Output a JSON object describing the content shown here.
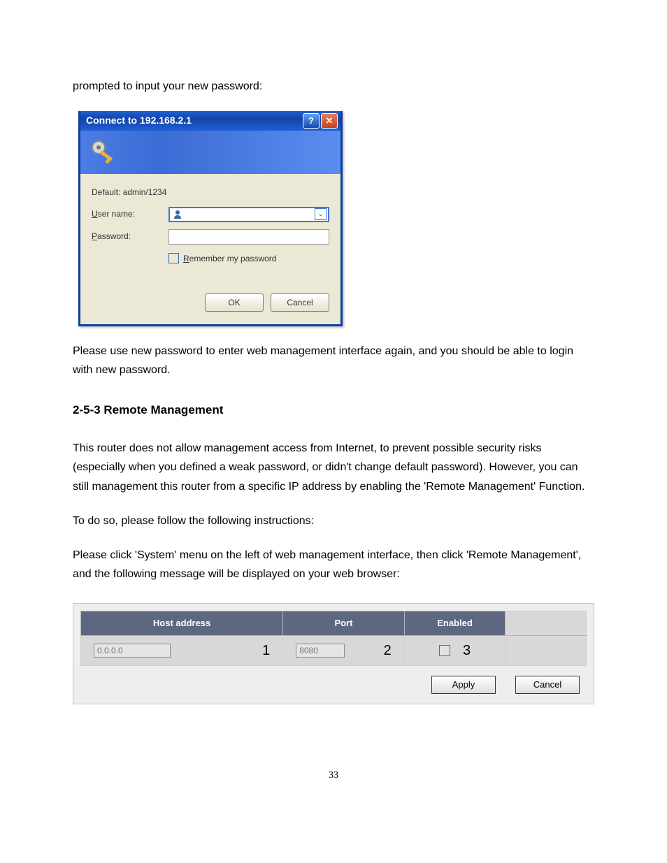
{
  "intro_text": "prompted to input your new password:",
  "dialog": {
    "title": "Connect to 192.168.2.1",
    "hint": "Default: admin/1234",
    "labels": {
      "user_prefix": "U",
      "user_rest": "ser name:",
      "pass_prefix": "P",
      "pass_rest": "assword:",
      "remember_prefix": "R",
      "remember_rest": "emember my password"
    },
    "ok": "OK",
    "cancel": "Cancel"
  },
  "post_dialog": "Please use new password to enter web management interface again, and you should be able to login with new password.",
  "section_heading": "2-5-3 Remote Management",
  "section_p1": "This router does not allow management access from Internet, to prevent possible security risks (especially when you defined a weak password, or didn't change default password). However, you can still management this router from a specific IP address by enabling the 'Remote Management' Function.",
  "section_p2": "To do so, please follow the following instructions:",
  "section_p3": "Please click 'System' menu on the left of web management interface, then click 'Remote Management', and the following message will be displayed on your web browser:",
  "remote": {
    "headers": {
      "host": "Host address",
      "port": "Port",
      "enabled": "Enabled"
    },
    "row": {
      "host_placeholder": "0.0.0.0",
      "host_annot": "1",
      "port_placeholder": "8080",
      "port_annot": "2",
      "enabled_annot": "3"
    },
    "apply": "Apply",
    "cancel": "Cancel"
  },
  "page_number": "33"
}
